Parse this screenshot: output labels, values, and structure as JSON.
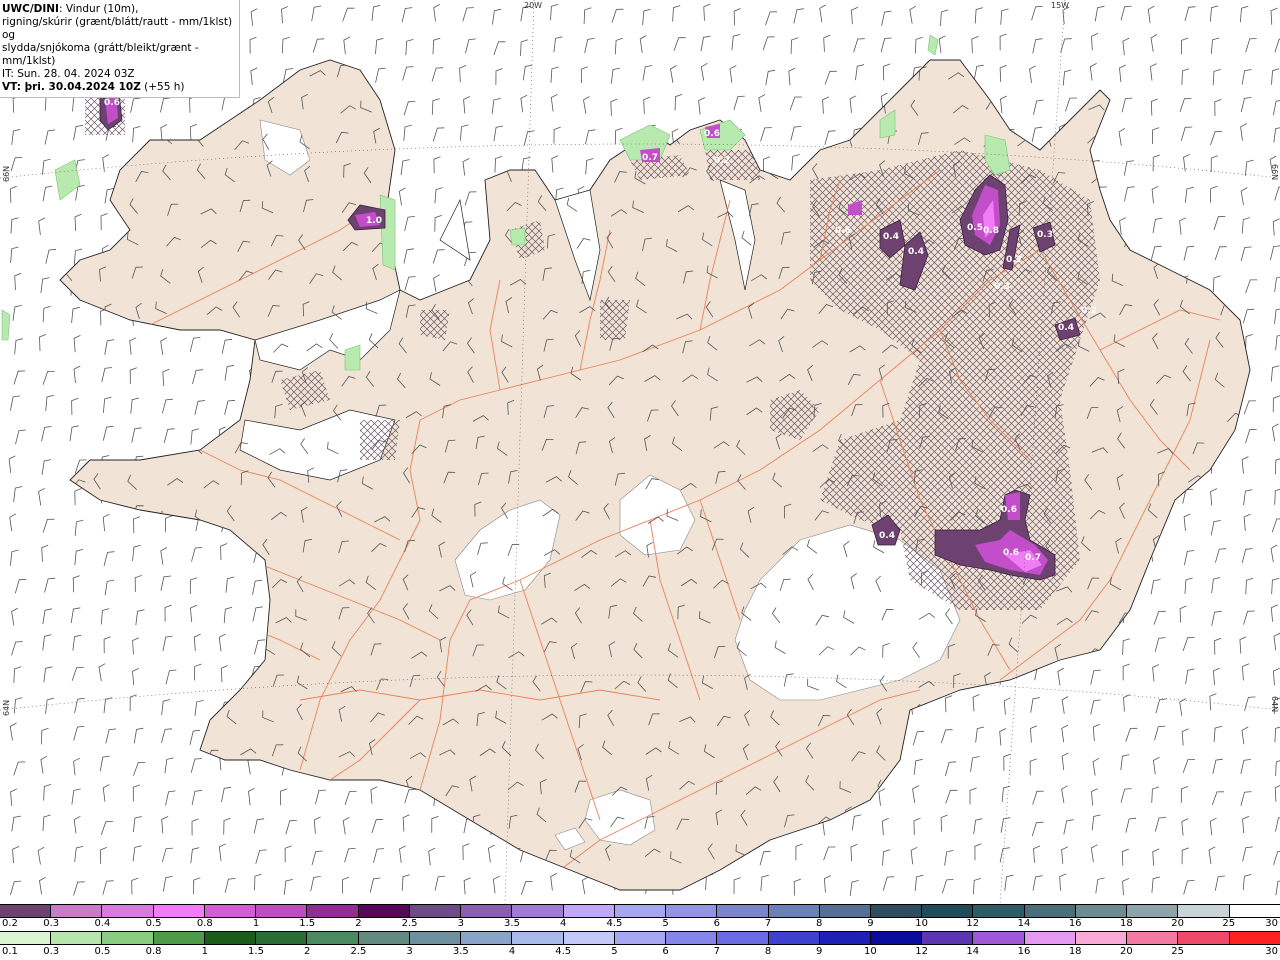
{
  "header": {
    "model": "UWC/DINI",
    "title_rest": ": Vindur (10m),",
    "line2": "rigning/skúrir (grænt/blátt/rautt - mm/1klst) og",
    "line3": "slydda/snjókoma (grátt/bleikt/grænt - mm/1klst)",
    "line4": "IT: Sun. 28. 04. 2024 03Z",
    "valid_prefix": "VT: þri. 30.04.2024 10Z",
    "valid_suffix": " (+55 h)"
  },
  "grid_labels": {
    "lon_20w": "20W",
    "lon_15w": "15W",
    "lat_66n_left": "66N",
    "lat_66n_right": "66N",
    "lat_64n_left": "64N",
    "lat_64n_right": "64N"
  },
  "precip_labels": [
    {
      "text": "0.6"
    },
    {
      "text": "1.0"
    },
    {
      "text": "0.7"
    },
    {
      "text": "0.6"
    },
    {
      "text": "0.2"
    },
    {
      "text": "0.6"
    },
    {
      "text": "0.4"
    },
    {
      "text": "0.4"
    },
    {
      "text": "0.5"
    },
    {
      "text": "0.8"
    },
    {
      "text": "0.3"
    },
    {
      "text": "0.2"
    },
    {
      "text": "0.3"
    },
    {
      "text": "0.4"
    },
    {
      "text": "0.2"
    },
    {
      "text": "0.4"
    },
    {
      "text": "0.6"
    },
    {
      "text": "0.6"
    },
    {
      "text": "0.7"
    }
  ],
  "colors": {
    "land": "#f1e4d7",
    "sea": "#ffffff",
    "roads": "#e8825a",
    "glacier": "#ffffff",
    "snow_purple": "#c24fc9",
    "rain_green": "#b8eab0"
  },
  "scale_top": {
    "colors": [
      "#6e4270",
      "#c57dc7",
      "#d67dd9",
      "#f07df5",
      "#d25ed4",
      "#bb4fbd",
      "#8f2d91",
      "#540a57",
      "#6e4a87",
      "#8a60ae",
      "#a27cd3",
      "#c0a8f2",
      "#a7a7ee",
      "#9494e0",
      "#7b86c9",
      "#6b80b3",
      "#556f97",
      "#2e4e60",
      "#224b59",
      "#2d5b66",
      "#4a6e7a",
      "#6e8b92",
      "#8ea3a9",
      "#c8d4d6",
      "#ffffff"
    ],
    "labels": [
      "0.2",
      "0.3",
      "0.4",
      "0.5",
      "0.8",
      "1",
      "1.5",
      "2",
      "2.5",
      "3",
      "3.5",
      "4",
      "4.5",
      "5",
      "6",
      "7",
      "8",
      "9",
      "10",
      "12",
      "14",
      "16",
      "18",
      "20",
      "25",
      "30"
    ]
  },
  "scale_bottom": {
    "colors": [
      "#d9f5d3",
      "#b7e5ae",
      "#8acc80",
      "#4f9a48",
      "#1b5c1b",
      "#2b6b34",
      "#4a8a5e",
      "#628a80",
      "#6e909e",
      "#8aa4c8",
      "#a9b9e9",
      "#c2c9f8",
      "#a7a7f2",
      "#8686e8",
      "#6a6ae3",
      "#4040cf",
      "#2020b8",
      "#0b0ba0",
      "#5a36b0",
      "#a058d6",
      "#e49af0",
      "#f8a9d5",
      "#f27aa3",
      "#f04a6a",
      "#ff2020"
    ],
    "labels": [
      "0.1",
      "0.3",
      "0.5",
      "0.8",
      "1",
      "1.5",
      "2",
      "2.5",
      "3",
      "3.5",
      "4",
      "4.5",
      "5",
      "6",
      "7",
      "8",
      "9",
      "10",
      "12",
      "14",
      "16",
      "18",
      "20",
      "25",
      "30"
    ]
  }
}
